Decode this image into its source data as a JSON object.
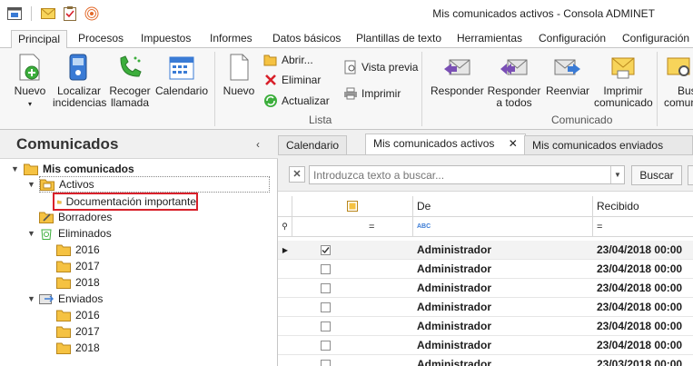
{
  "window": {
    "title": "Mis comunicados activos - Consola ADMINET"
  },
  "quick_access": [
    "window-icon",
    "mail-icon",
    "clipboard-icon",
    "broadcast-icon"
  ],
  "ribbon_tabs": [
    "Principal",
    "Procesos",
    "Impuestos",
    "Informes",
    "Datos básicos",
    "Plantillas de texto",
    "Herramientas",
    "Configuración",
    "Configuración pe"
  ],
  "ribbon": {
    "nuevo": "Nuevo",
    "localizar_line1": "Localizar",
    "localizar_line2": "incidencias",
    "recoger_line1": "Recoger",
    "recoger_line2": "llamada",
    "calendario": "Calendario",
    "nuevo2": "Nuevo",
    "abrir": "Abrir...",
    "eliminar": "Eliminar",
    "actualizar": "Actualizar",
    "vista_previa": "Vista previa",
    "imprimir": "Imprimir",
    "group_lista": "Lista",
    "responder": "Responder",
    "responder_todos_line1": "Responder",
    "responder_todos_line2": "a todos",
    "reenviar": "Reenviar",
    "imprimir_com_line1": "Imprimir",
    "imprimir_com_line2": "comunicado",
    "buscar_line1": "Bus",
    "buscar_line2": "comun",
    "group_comunicado": "Comunicado"
  },
  "left_panel": {
    "title": "Comunicados",
    "collapse": "‹",
    "tree": {
      "mis_comunicados": "Mis comunicados",
      "activos": "Activos",
      "documentacion": "Documentación importante",
      "borradores": "Borradores",
      "eliminados": "Eliminados",
      "el_2016": "2016",
      "el_2017": "2017",
      "el_2018": "2018",
      "enviados": "Enviados",
      "en_2016": "2016",
      "en_2017": "2017",
      "en_2018": "2018"
    }
  },
  "doc_tabs": {
    "calendario": "Calendario",
    "activos": "Mis comunicados activos",
    "close": "✕",
    "enviados": "Mis comunicados enviados"
  },
  "find": {
    "placeholder": "Introduzca texto a buscar...",
    "button": "Buscar"
  },
  "grid": {
    "col_de": "De",
    "col_recibido": "Recibido",
    "filter_eq": "=",
    "filter_abc": "ABC",
    "rows": [
      {
        "checked": true,
        "from": "Administrador",
        "received": "23/04/2018 00:00"
      },
      {
        "checked": false,
        "from": "Administrador",
        "received": "23/04/2018 00:00"
      },
      {
        "checked": false,
        "from": "Administrador",
        "received": "23/04/2018 00:00"
      },
      {
        "checked": false,
        "from": "Administrador",
        "received": "23/04/2018 00:00"
      },
      {
        "checked": false,
        "from": "Administrador",
        "received": "23/04/2018 00:00"
      },
      {
        "checked": false,
        "from": "Administrador",
        "received": "23/04/2018 00:00"
      },
      {
        "checked": false,
        "from": "Administrador",
        "received": "23/03/2018 00:00"
      }
    ]
  },
  "colors": {
    "accent_red": "#d8202a",
    "folder_yellow": "#f5c242",
    "ribbon_bg": "#f7f7f7"
  }
}
